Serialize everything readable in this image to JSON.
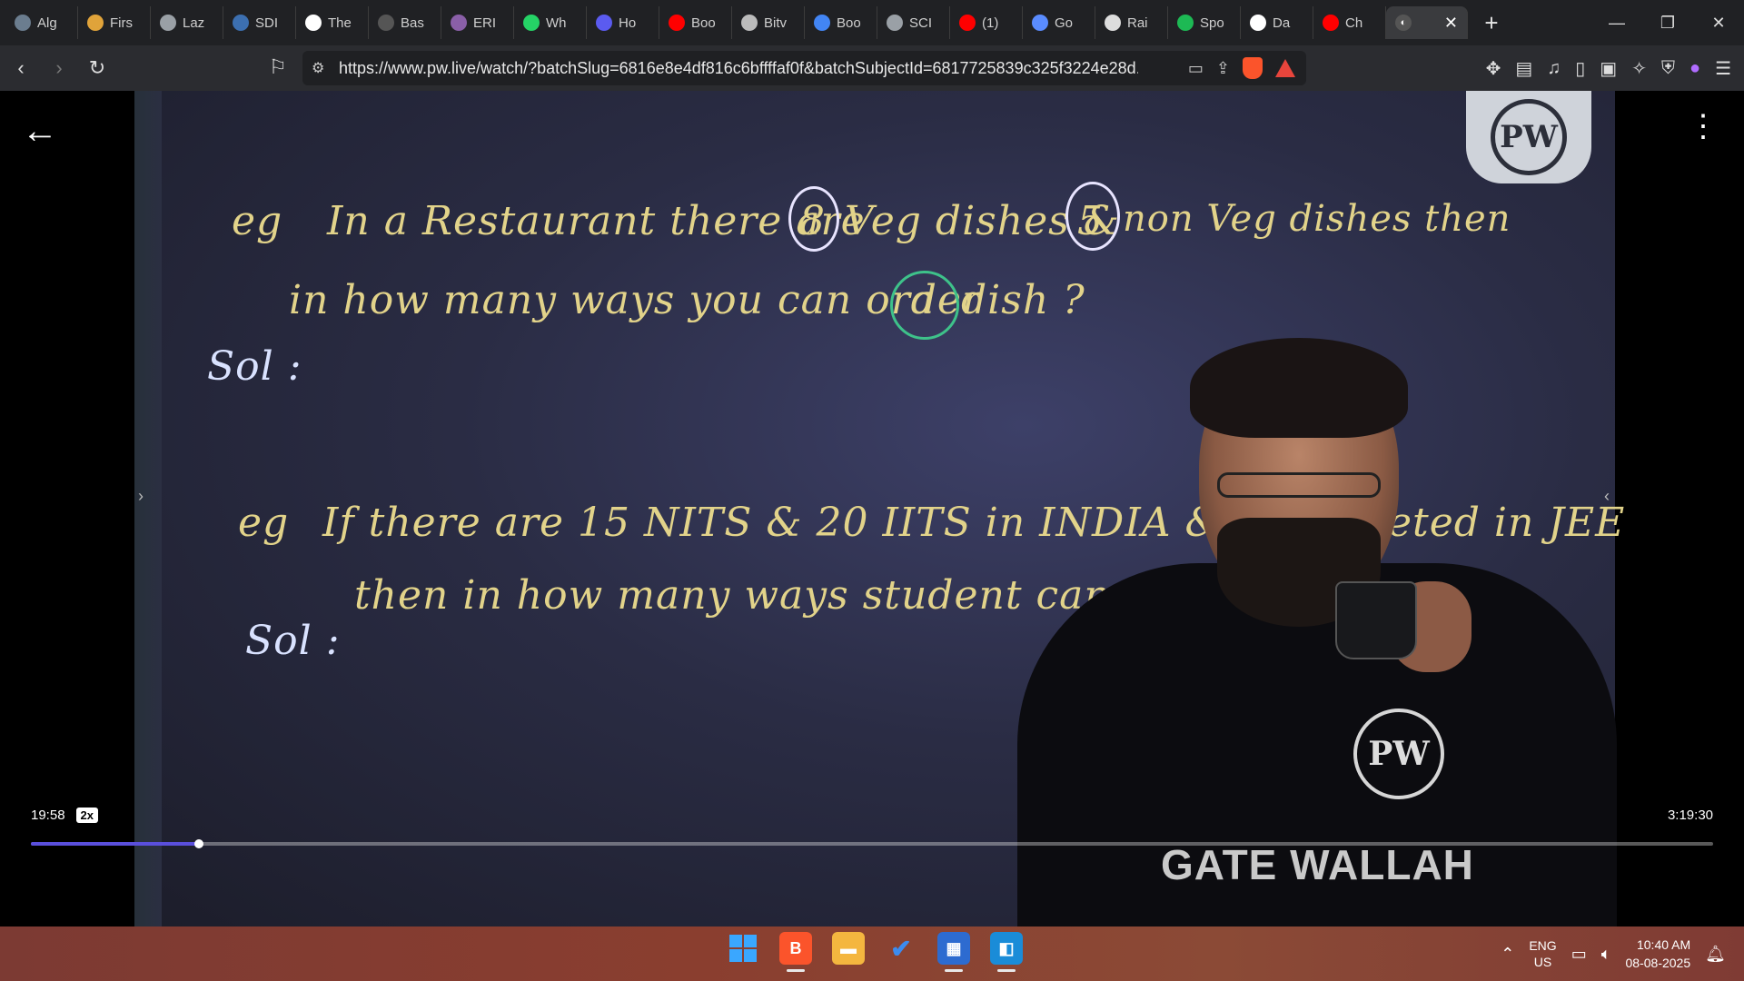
{
  "browser": {
    "tabs": [
      {
        "label": "Alg",
        "icon": "ai-icon",
        "color": "#6b7d8f"
      },
      {
        "label": "Firs",
        "icon": "lightning-icon",
        "color": "#e0a33a"
      },
      {
        "label": "Laz",
        "icon": "globe-icon",
        "color": "#9aa0a6"
      },
      {
        "label": "SDI",
        "icon": "grid-icon",
        "color": "#3c6fb0"
      },
      {
        "label": "The",
        "icon": "w3-icon",
        "color": "#ffffff"
      },
      {
        "label": "Bas",
        "icon": "box-icon",
        "color": "#555555"
      },
      {
        "label": "ERI",
        "icon": "brain-icon",
        "color": "#8a5fa8"
      },
      {
        "label": "Wh",
        "icon": "whatsapp-icon",
        "color": "#25d366"
      },
      {
        "label": "Ho",
        "icon": "bolt-icon",
        "color": "#5b5bf0"
      },
      {
        "label": "Boo",
        "icon": "youtube-icon",
        "color": "#ff0000"
      },
      {
        "label": "Bitv",
        "icon": "bitwise-icon",
        "color": "#bbbbbb"
      },
      {
        "label": "Boo",
        "icon": "google-icon",
        "color": "#4285f4"
      },
      {
        "label": "SCI",
        "icon": "globe-icon",
        "color": "#9aa0a6"
      },
      {
        "label": "(1)",
        "icon": "youtube-icon",
        "color": "#ff0000"
      },
      {
        "label": "Go",
        "icon": "gemini-icon",
        "color": "#5a8cff"
      },
      {
        "label": "Rai",
        "icon": "openai-icon",
        "color": "#dddddd"
      },
      {
        "label": "Spo",
        "icon": "spotify-icon",
        "color": "#1db954"
      },
      {
        "label": "Da",
        "icon": "wikipedia-icon",
        "color": "#ffffff"
      },
      {
        "label": "Ch",
        "icon": "youtube-icon",
        "color": "#ff0000"
      }
    ],
    "new_tab_label": "+",
    "url": "https://www.pw.live/watch/?batchSlug=6816e8e4df816c6bffffaf0f&batchSubjectId=6817725839c325f3224e28d..."
  },
  "video": {
    "current_time": "19:58",
    "speed": "2x",
    "duration": "3:19:30",
    "progress_fraction": 0.1,
    "logo_text": "PW",
    "shirt_logo": "PW",
    "banner_text": "GATE WALLAH",
    "board": {
      "q1_prefix": "eg",
      "q1_line1a": "In a Restaurant there are",
      "q1_num1": "8",
      "q1_line1b": "Veg dishes &",
      "q1_num2": "5",
      "q1_line1c": "non Veg dishes then",
      "q1_line2a": "in how many ways you can order",
      "q1_circled": "a",
      "q1_line2b": "dish ?",
      "sol1": "Sol :",
      "q2_prefix": "eg",
      "q2_line1a": "If there are 15 NITS & 20 IITS in INDIA &",
      "q2_line1b": "eted in JEE",
      "q2_line2": "then in how many ways student can choose a col",
      "sol2": "Sol :"
    }
  },
  "taskbar": {
    "lang_line1": "ENG",
    "lang_line2": "US",
    "time": "10:40 AM",
    "date": "08-08-2025"
  }
}
